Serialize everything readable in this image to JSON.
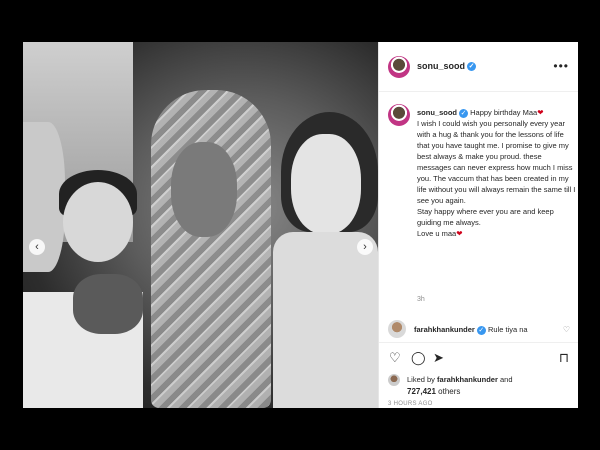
{
  "post": {
    "username": "sonu_sood",
    "caption_lines": [
      "Happy birthday Maa",
      "I wish I could wish you personally every year with a hug & thank you for the lessons of life that you have taught me. I promise to give my best always & make you proud. these messages can never express how much I miss you. The vaccum that has been created in my life without you will always remain the same till I see you again.",
      "Stay happy where ever you are and keep guiding me always.",
      "Love u maa"
    ],
    "caption_time": "3h",
    "comment": {
      "username": "farahkhankunder",
      "text": "Rule tiya na"
    },
    "liked_by_label": "Liked by",
    "liked_by_user": "farahkhankunder",
    "liked_by_and": "and",
    "others_count": "727,421",
    "others_label": "others",
    "posted_ago": "3 HOURS AGO"
  },
  "icons": {
    "more": "more-icon",
    "like": "heart-icon",
    "comment": "comment-icon",
    "share": "share-icon",
    "save": "bookmark-icon",
    "verified": "verified-badge-icon",
    "heart_emoji": "red-heart-emoji"
  },
  "colors": {
    "verified": "#3897f0",
    "heart": "#d0021b",
    "text": "#262626",
    "muted": "#8e8e8e"
  }
}
